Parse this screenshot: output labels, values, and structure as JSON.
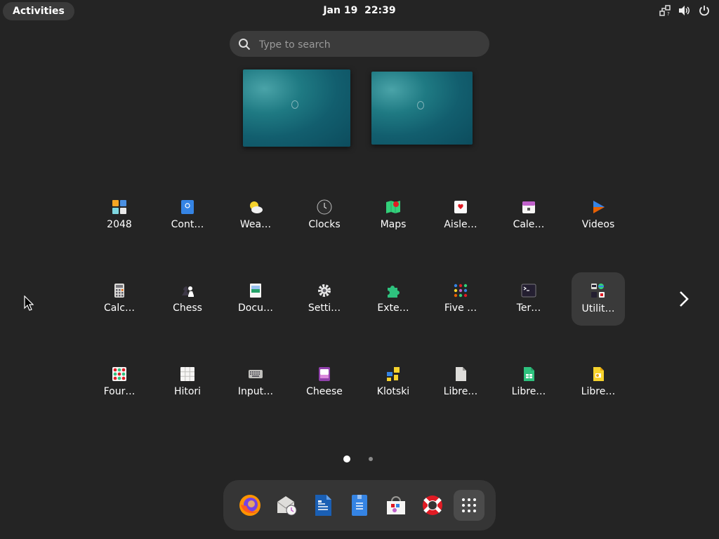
{
  "topbar": {
    "activities_label": "Activities",
    "date": "Jan 19",
    "time": "22:39"
  },
  "search": {
    "placeholder": "Type to search"
  },
  "app_grid": {
    "rows": [
      [
        {
          "label": "2048",
          "icon": "2048-icon"
        },
        {
          "label": "Cont…",
          "icon": "contacts-icon"
        },
        {
          "label": "Wea…",
          "icon": "weather-icon"
        },
        {
          "label": "Clocks",
          "icon": "clocks-icon"
        },
        {
          "label": "Maps",
          "icon": "maps-icon"
        },
        {
          "label": "Aisle…",
          "icon": "aisleriot-icon"
        },
        {
          "label": "Cale…",
          "icon": "calendar-icon"
        },
        {
          "label": "Videos",
          "icon": "videos-icon"
        }
      ],
      [
        {
          "label": "Calc…",
          "icon": "calculator-icon"
        },
        {
          "label": "Chess",
          "icon": "chess-icon"
        },
        {
          "label": "Docu…",
          "icon": "document-viewer-icon"
        },
        {
          "label": "Setti…",
          "icon": "settings-icon"
        },
        {
          "label": "Exte…",
          "icon": "extensions-icon"
        },
        {
          "label": "Five …",
          "icon": "five-or-more-icon"
        },
        {
          "label": "Ter…",
          "icon": "terminal-icon"
        },
        {
          "label": "Utilit…",
          "icon": "utilities-folder-icon",
          "selected": true
        }
      ],
      [
        {
          "label": "Four…",
          "icon": "four-in-a-row-icon"
        },
        {
          "label": "Hitori",
          "icon": "hitori-icon"
        },
        {
          "label": "Input…",
          "icon": "input-method-icon"
        },
        {
          "label": "Cheese",
          "icon": "cheese-icon"
        },
        {
          "label": "Klotski",
          "icon": "klotski-icon"
        },
        {
          "label": "Libre…",
          "icon": "libreoffice-icon"
        },
        {
          "label": "Libre…",
          "icon": "libreoffice-calc-icon"
        },
        {
          "label": "Libre…",
          "icon": "libreoffice-impress-icon"
        }
      ]
    ]
  },
  "pagination": {
    "pages": 2,
    "current": 1
  },
  "dock": {
    "items": [
      {
        "name": "firefox",
        "icon": "firefox-icon"
      },
      {
        "name": "evolution",
        "icon": "mail-clock-icon"
      },
      {
        "name": "writer",
        "icon": "libreoffice-writer-icon"
      },
      {
        "name": "files",
        "icon": "files-icon"
      },
      {
        "name": "software",
        "icon": "software-icon"
      },
      {
        "name": "help",
        "icon": "help-lifebuoy-icon"
      },
      {
        "name": "show-apps",
        "icon": "app-grid-icon",
        "selected": true
      }
    ]
  },
  "colors": {
    "background": "#242424",
    "surface": "#3a3a3a",
    "dock": "#353535",
    "accent_blue": "#3584e4"
  }
}
